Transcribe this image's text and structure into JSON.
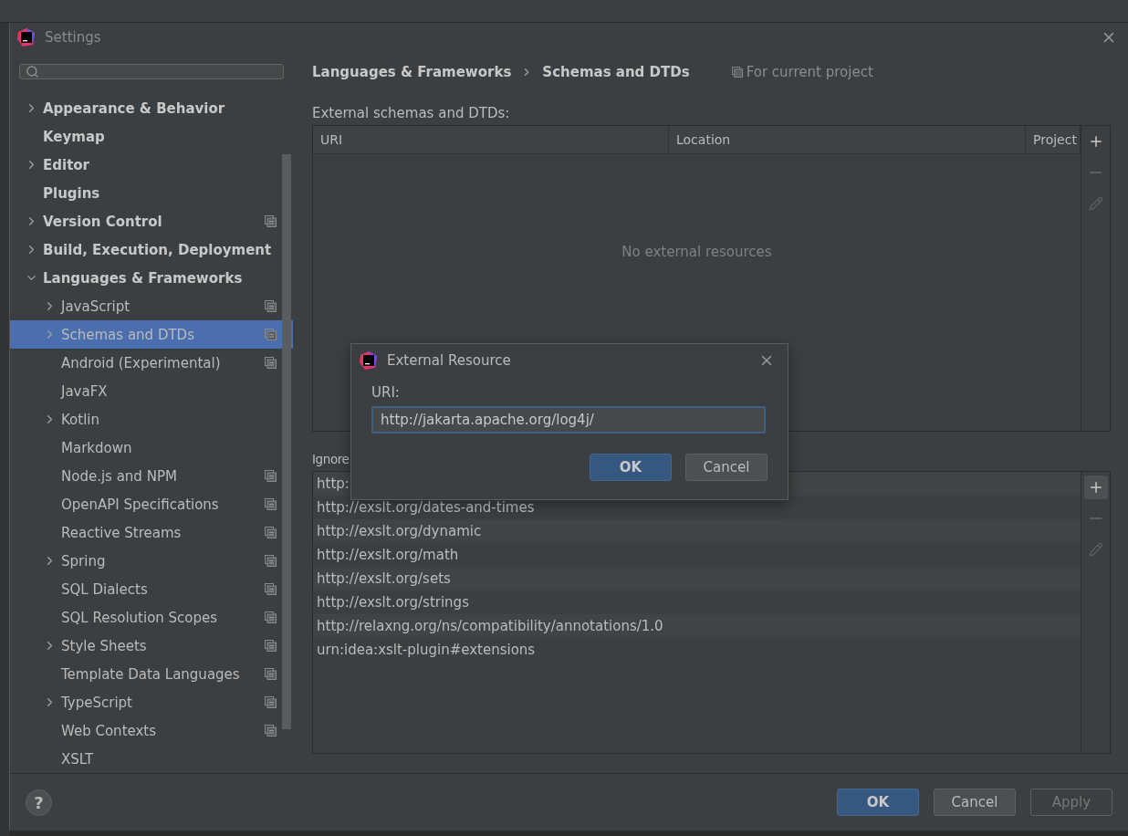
{
  "window": {
    "title": "Settings"
  },
  "sidebar": {
    "items": [
      {
        "label": "Appearance & Behavior",
        "expanded": false,
        "project_level": false,
        "selected": false
      },
      {
        "label": "Keymap",
        "project_level": false,
        "selected": false
      },
      {
        "label": "Editor",
        "expanded": false,
        "project_level": false,
        "selected": false
      },
      {
        "label": "Plugins",
        "project_level": false,
        "selected": false
      },
      {
        "label": "Version Control",
        "expanded": false,
        "project_level": true,
        "selected": false
      },
      {
        "label": "Build, Execution, Deployment",
        "expanded": false,
        "project_level": false,
        "selected": false
      },
      {
        "label": "Languages & Frameworks",
        "expanded": true,
        "project_level": false,
        "selected": false,
        "children": [
          {
            "label": "JavaScript",
            "expanded": false,
            "project_level": true,
            "selected": false
          },
          {
            "label": "Schemas and DTDs",
            "expanded": false,
            "project_level": true,
            "selected": true
          },
          {
            "label": "Android (Experimental)",
            "project_level": true,
            "selected": false
          },
          {
            "label": "JavaFX",
            "project_level": false,
            "selected": false
          },
          {
            "label": "Kotlin",
            "expanded": false,
            "project_level": false,
            "selected": false
          },
          {
            "label": "Markdown",
            "project_level": false,
            "selected": false
          },
          {
            "label": "Node.js and NPM",
            "project_level": true,
            "selected": false
          },
          {
            "label": "OpenAPI Specifications",
            "project_level": true,
            "selected": false
          },
          {
            "label": "Reactive Streams",
            "project_level": true,
            "selected": false
          },
          {
            "label": "Spring",
            "expanded": false,
            "project_level": true,
            "selected": false
          },
          {
            "label": "SQL Dialects",
            "project_level": true,
            "selected": false
          },
          {
            "label": "SQL Resolution Scopes",
            "project_level": true,
            "selected": false
          },
          {
            "label": "Style Sheets",
            "expanded": false,
            "project_level": true,
            "selected": false
          },
          {
            "label": "Template Data Languages",
            "project_level": true,
            "selected": false
          },
          {
            "label": "TypeScript",
            "expanded": false,
            "project_level": true,
            "selected": false
          },
          {
            "label": "Web Contexts",
            "project_level": true,
            "selected": false
          },
          {
            "label": "XSLT",
            "project_level": false,
            "selected": false
          }
        ]
      }
    ]
  },
  "breadcrumb": [
    "Languages & Frameworks",
    "Schemas and DTDs"
  ],
  "scope_note": "For current project",
  "external": {
    "label": "External schemas and DTDs:",
    "columns": [
      "URI",
      "Location",
      "Project"
    ],
    "empty_text": "No external resources"
  },
  "ignored": {
    "label": "Ignore",
    "rows": [
      "http:",
      "http://exslt.org/dates-and-times",
      "http://exslt.org/dynamic",
      "http://exslt.org/math",
      "http://exslt.org/sets",
      "http://exslt.org/strings",
      "http://relaxng.org/ns/compatibility/annotations/1.0",
      "urn:idea:xslt-plugin#extensions"
    ]
  },
  "dialog": {
    "title": "External Resource",
    "field_label": "URI:",
    "value": "http://jakarta.apache.org/log4j/",
    "buttons": [
      {
        "label": "OK",
        "kind": "primary",
        "disabled": false
      },
      {
        "label": "Cancel",
        "kind": "secondary",
        "disabled": false
      }
    ]
  },
  "footer": {
    "help": "?",
    "buttons": [
      {
        "label": "OK",
        "kind": "primary",
        "disabled": false
      },
      {
        "label": "Cancel",
        "kind": "secondary",
        "disabled": false
      },
      {
        "label": "Apply",
        "kind": "secondary",
        "disabled": true
      }
    ]
  }
}
